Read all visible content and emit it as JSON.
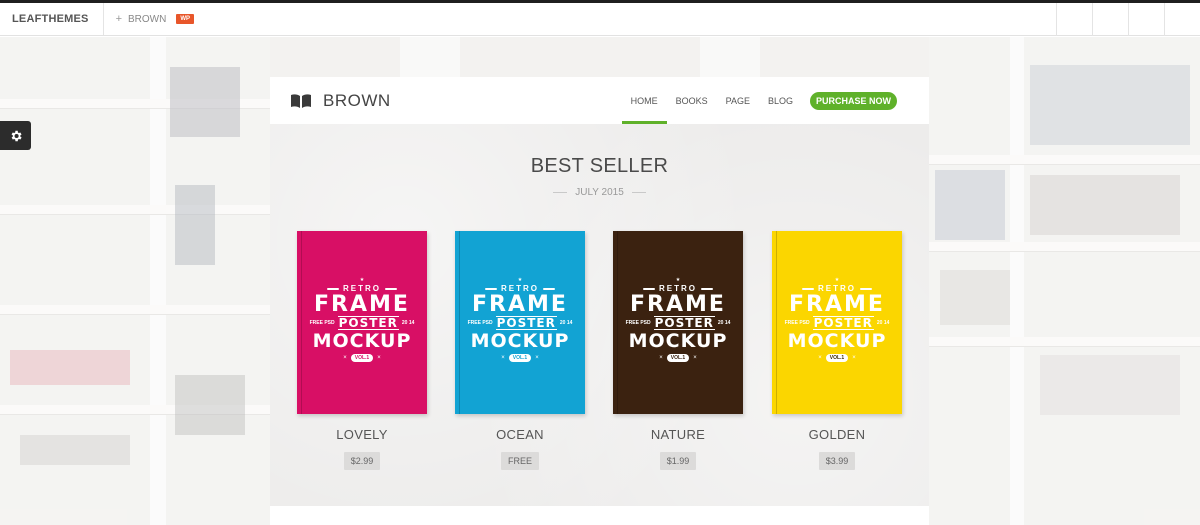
{
  "admin_bar": {
    "brand": "LEAFTHEMES",
    "theme_link": "BROWN",
    "badge": "WP"
  },
  "site": {
    "logo_text": "BROWN",
    "logo_icon": "open-book-icon",
    "nav": [
      {
        "label": "HOME",
        "active": true
      },
      {
        "label": "BOOKS",
        "active": false
      },
      {
        "label": "PAGE",
        "active": false
      },
      {
        "label": "BLOG",
        "active": false
      }
    ],
    "purchase_label": "PURCHASE NOW",
    "accent_color": "#5fb12a"
  },
  "section": {
    "title": "BEST SELLER",
    "subtitle": "JULY 2015"
  },
  "cover_text": {
    "retro": "RETRO",
    "frame": "FRAME",
    "poster": "POSTER",
    "left_small": "FREE PSD",
    "right_small": "20 14",
    "mockup": "MOCKUP",
    "vol": "VOL.1"
  },
  "products": [
    {
      "name": "LOVELY",
      "price": "$2.99",
      "cover_color": "#d80f65",
      "vol_text_color": "#d80f65"
    },
    {
      "name": "OCEAN",
      "price": "FREE",
      "cover_color": "#12a3d3",
      "vol_text_color": "#12a3d3"
    },
    {
      "name": "NATURE",
      "price": "$1.99",
      "cover_color": "#3b2210",
      "vol_text_color": "#3b2210"
    },
    {
      "name": "GOLDEN",
      "price": "$3.99",
      "cover_color": "#fbd600",
      "vol_text_color": "#3a2a00"
    }
  ],
  "settings_icon": "gear-icon"
}
